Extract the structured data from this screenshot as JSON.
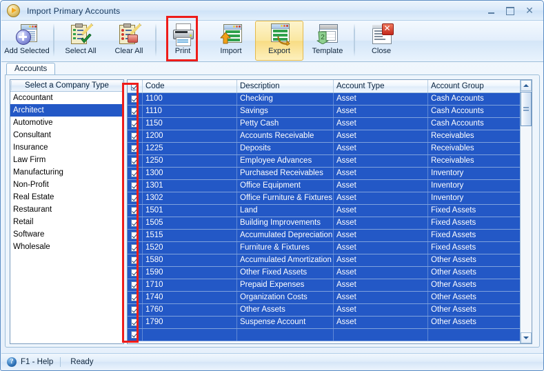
{
  "window": {
    "title": "Import Primary Accounts",
    "icon": "play-circle-icon",
    "controls": {
      "minimize": "Minimize",
      "maximize": "Maximize",
      "close": "Close"
    }
  },
  "toolbar": {
    "items": [
      {
        "label": "Add Selected",
        "icon": "add-selected-icon",
        "highlighted": false
      },
      {
        "label": "Select All",
        "icon": "select-all-icon",
        "highlighted": false
      },
      {
        "label": "Clear All",
        "icon": "clear-all-icon",
        "highlighted": false
      },
      {
        "label": "Print",
        "icon": "printer-icon",
        "highlighted": false
      },
      {
        "label": "Import",
        "icon": "import-icon",
        "highlighted": false
      },
      {
        "label": "Export",
        "icon": "export-icon",
        "highlighted": true
      },
      {
        "label": "Template",
        "icon": "template-icon",
        "highlighted": false
      },
      {
        "label": "Close",
        "icon": "close-document-icon",
        "highlighted": false
      }
    ]
  },
  "tabs": [
    {
      "label": "Accounts",
      "active": true
    }
  ],
  "sidebar": {
    "header": "Select a Company Type",
    "selected": "Architect",
    "items": [
      "Accountant",
      "Architect",
      "Automotive",
      "Consultant",
      "Insurance",
      "Law Firm",
      "Manufacturing",
      "Non-Profit",
      "Real Estate",
      "Restaurant",
      "Retail",
      "Software",
      "Wholesale"
    ]
  },
  "grid": {
    "columns": [
      "",
      "Code",
      "Description",
      "Account Type",
      "Account Group"
    ],
    "header_checkbox_checked": true,
    "rows": [
      {
        "checked": true,
        "code": "1100",
        "description": "Checking",
        "type": "Asset",
        "group": "Cash Accounts"
      },
      {
        "checked": true,
        "code": "1110",
        "description": "Savings",
        "type": "Asset",
        "group": "Cash Accounts"
      },
      {
        "checked": true,
        "code": "1150",
        "description": "Petty Cash",
        "type": "Asset",
        "group": "Cash Accounts"
      },
      {
        "checked": true,
        "code": "1200",
        "description": "Accounts Receivable",
        "type": "Asset",
        "group": "Receivables"
      },
      {
        "checked": true,
        "code": "1225",
        "description": "Deposits",
        "type": "Asset",
        "group": "Receivables"
      },
      {
        "checked": true,
        "code": "1250",
        "description": "Employee Advances",
        "type": "Asset",
        "group": "Receivables"
      },
      {
        "checked": true,
        "code": "1300",
        "description": "Purchased Receivables",
        "type": "Asset",
        "group": "Inventory"
      },
      {
        "checked": true,
        "code": "1301",
        "description": "Office Equipment",
        "type": "Asset",
        "group": "Inventory"
      },
      {
        "checked": true,
        "code": "1302",
        "description": "Office Furniture & Fixtures",
        "type": "Asset",
        "group": "Inventory"
      },
      {
        "checked": true,
        "code": "1501",
        "description": "Land",
        "type": "Asset",
        "group": "Fixed Assets"
      },
      {
        "checked": true,
        "code": "1505",
        "description": "Building Improvements",
        "type": "Asset",
        "group": "Fixed Assets"
      },
      {
        "checked": true,
        "code": "1515",
        "description": "Accumulated Depreciation",
        "type": "Asset",
        "group": "Fixed Assets"
      },
      {
        "checked": true,
        "code": "1520",
        "description": "Furniture & Fixtures",
        "type": "Asset",
        "group": "Fixed Assets"
      },
      {
        "checked": true,
        "code": "1580",
        "description": "Accumulated Amortization",
        "type": "Asset",
        "group": "Other Assets"
      },
      {
        "checked": true,
        "code": "1590",
        "description": "Other Fixed Assets",
        "type": "Asset",
        "group": "Other Assets"
      },
      {
        "checked": true,
        "code": "1710",
        "description": "Prepaid Expenses",
        "type": "Asset",
        "group": "Other Assets"
      },
      {
        "checked": true,
        "code": "1740",
        "description": "Organization Costs",
        "type": "Asset",
        "group": "Other Assets"
      },
      {
        "checked": true,
        "code": "1760",
        "description": "Other Assets",
        "type": "Asset",
        "group": "Other Assets"
      },
      {
        "checked": true,
        "code": "1790",
        "description": "Suspense Account",
        "type": "Asset",
        "group": "Other Assets"
      },
      {
        "checked": true,
        "code": "",
        "description": "",
        "type": "",
        "group": ""
      }
    ],
    "scrollbar": {
      "position": "near-top"
    }
  },
  "statusbar": {
    "help": "F1 - Help",
    "status": "Ready"
  },
  "annotations": [
    {
      "name": "export-button-highlight",
      "color": "#ee1c19"
    },
    {
      "name": "checkbox-column-highlight",
      "color": "#ee1c19"
    }
  ],
  "colors": {
    "selection_blue": "#2358c6",
    "annotation_red": "#ee1c19",
    "toolbar_hot": "#f8dc84",
    "title_text": "#14365c"
  }
}
